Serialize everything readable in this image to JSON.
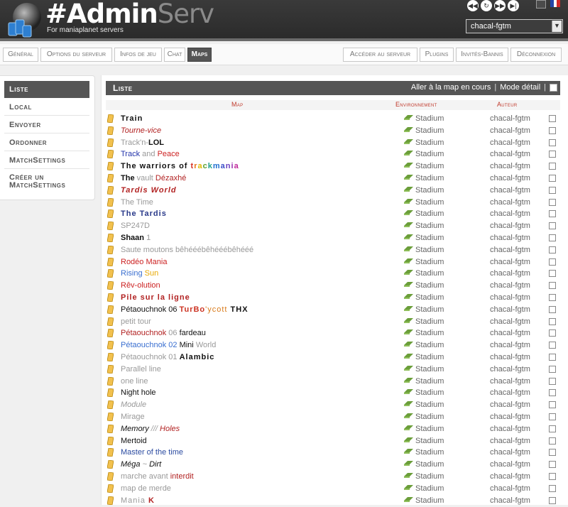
{
  "app": {
    "brand_main": "#Admin",
    "brand_suffix": "Serv",
    "tagline": "For maniaplanet servers"
  },
  "header": {
    "server": "chacal-fgtm",
    "media_icons": [
      "rewind-icon",
      "restart-icon",
      "forward-icon",
      "next-icon"
    ],
    "lang_flags": [
      "gb-flag-icon",
      "fr-flag-icon"
    ]
  },
  "nav": {
    "left": [
      "Général",
      "Options du serveur",
      "Infos de jeu",
      "Chat",
      "Maps"
    ],
    "right": [
      "Accéder au serveur",
      "Plugins",
      "Invités-Bannis",
      "Déconnexion"
    ],
    "active": "Maps"
  },
  "sidebar": {
    "items": [
      "Liste",
      "Local",
      "Envoyer",
      "Ordonner",
      "MatchSettings",
      "Créer un MatchSettings"
    ],
    "active": "Liste"
  },
  "panel": {
    "title": "Liste",
    "goto_current": "Aller à la map en cours",
    "detail_mode": "Mode détail",
    "col_map": "Map",
    "col_env": "Environnement",
    "col_author": "Auteur"
  },
  "colors": {
    "accent_red": "#c0392b",
    "header_dark": "#2e2e2e",
    "panel_head": "#555555",
    "env_icon": "#6b9e3a"
  },
  "maps": [
    {
      "segments": [
        {
          "text": "Train",
          "color": "#111111",
          "style": "b wide"
        }
      ],
      "environment": "Stadium",
      "author": "chacal-fgtm"
    },
    {
      "segments": [
        {
          "text": "Tourne-vice",
          "color": "#b22222",
          "style": "i"
        }
      ],
      "environment": "Stadium",
      "author": "chacal-fgtm"
    },
    {
      "segments": [
        {
          "text": "Track'n-",
          "color": "#999999",
          "style": ""
        },
        {
          "text": "LOL",
          "color": "#111111",
          "style": "b"
        }
      ],
      "environment": "Stadium",
      "author": "chacal-fgtm"
    },
    {
      "segments": [
        {
          "text": "Track ",
          "color": "#2233aa",
          "style": ""
        },
        {
          "text": "and ",
          "color": "#999999",
          "style": ""
        },
        {
          "text": "Peace",
          "color": "#cc2222",
          "style": ""
        }
      ],
      "environment": "Stadium",
      "author": "chacal-fgtm"
    },
    {
      "segments": [
        {
          "text": "The warriors of ",
          "color": "#111111",
          "style": "b wide"
        },
        {
          "text": "t",
          "color": "#d62d20",
          "style": "b wide"
        },
        {
          "text": "r",
          "color": "#e8741a",
          "style": "b wide"
        },
        {
          "text": "a",
          "color": "#e0b800",
          "style": "b wide"
        },
        {
          "text": "c",
          "color": "#5aa02c",
          "style": "b wide"
        },
        {
          "text": "k",
          "color": "#1f9f8a",
          "style": "b wide"
        },
        {
          "text": "m",
          "color": "#1f6fd0",
          "style": "b wide"
        },
        {
          "text": "a",
          "color": "#3b4ec8",
          "style": "b wide"
        },
        {
          "text": "n",
          "color": "#6a3fc0",
          "style": "b wide"
        },
        {
          "text": "i",
          "color": "#9a2fb0",
          "style": "b wide"
        },
        {
          "text": "a",
          "color": "#c0289a",
          "style": "b wide"
        }
      ],
      "environment": "Stadium",
      "author": "chacal-fgtm"
    },
    {
      "segments": [
        {
          "text": "The ",
          "color": "#111111",
          "style": "b"
        },
        {
          "text": "vault ",
          "color": "#999999",
          "style": ""
        },
        {
          "text": "Dézaxhé",
          "color": "#b22222",
          "style": ""
        }
      ],
      "environment": "Stadium",
      "author": "chacal-fgtm"
    },
    {
      "segments": [
        {
          "text": "Tardis World",
          "color": "#b22222",
          "style": "b i wide"
        }
      ],
      "environment": "Stadium",
      "author": "chacal-fgtm"
    },
    {
      "segments": [
        {
          "text": "The Time",
          "color": "#999999",
          "style": ""
        }
      ],
      "environment": "Stadium",
      "author": "chacal-fgtm"
    },
    {
      "segments": [
        {
          "text": "The Tardis",
          "color": "#2a3a8a",
          "style": "b wide"
        }
      ],
      "environment": "Stadium",
      "author": "chacal-fgtm"
    },
    {
      "segments": [
        {
          "text": "SP247D",
          "color": "#999999",
          "style": ""
        }
      ],
      "environment": "Stadium",
      "author": "chacal-fgtm"
    },
    {
      "segments": [
        {
          "text": "Shaan ",
          "color": "#111111",
          "style": "b"
        },
        {
          "text": "1",
          "color": "#999999",
          "style": ""
        }
      ],
      "environment": "Stadium",
      "author": "chacal-fgtm"
    },
    {
      "segments": [
        {
          "text": "Saute moutons bêhééébêhééébêhééé",
          "color": "#999999",
          "style": ""
        }
      ],
      "environment": "Stadium",
      "author": "chacal-fgtm"
    },
    {
      "segments": [
        {
          "text": "Rodéo Mania",
          "color": "#cc2222",
          "style": ""
        }
      ],
      "environment": "Stadium",
      "author": "chacal-fgtm"
    },
    {
      "segments": [
        {
          "text": "Rising ",
          "color": "#3a6fd0",
          "style": ""
        },
        {
          "text": "Sun",
          "color": "#e8a800",
          "style": ""
        }
      ],
      "environment": "Stadium",
      "author": "chacal-fgtm"
    },
    {
      "segments": [
        {
          "text": "Rêv-olution",
          "color": "#cc2222",
          "style": ""
        }
      ],
      "environment": "Stadium",
      "author": "chacal-fgtm"
    },
    {
      "segments": [
        {
          "text": "Pile sur la ligne",
          "color": "#b22222",
          "style": "b wide"
        }
      ],
      "environment": "Stadium",
      "author": "chacal-fgtm"
    },
    {
      "segments": [
        {
          "text": "Pétaouchnok 06 ",
          "color": "#111111",
          "style": ""
        },
        {
          "text": "TurBo",
          "color": "#cc3322",
          "style": "b wide"
        },
        {
          "text": "'ycott ",
          "color": "#d97a1a",
          "style": "wide"
        },
        {
          "text": "THX",
          "color": "#111111",
          "style": "b wide"
        }
      ],
      "environment": "Stadium",
      "author": "chacal-fgtm"
    },
    {
      "segments": [
        {
          "text": "petit tour",
          "color": "#999999",
          "style": ""
        }
      ],
      "environment": "Stadium",
      "author": "chacal-fgtm"
    },
    {
      "segments": [
        {
          "text": "Pétaouchnok ",
          "color": "#b22222",
          "style": ""
        },
        {
          "text": "06 ",
          "color": "#999999",
          "style": ""
        },
        {
          "text": "fardeau",
          "color": "#111111",
          "style": ""
        }
      ],
      "environment": "Stadium",
      "author": "chacal-fgtm"
    },
    {
      "segments": [
        {
          "text": "Pétaouchnok 02 ",
          "color": "#3a6fd0",
          "style": ""
        },
        {
          "text": "Mini ",
          "color": "#111111",
          "style": ""
        },
        {
          "text": "World",
          "color": "#999999",
          "style": ""
        }
      ],
      "environment": "Stadium",
      "author": "chacal-fgtm"
    },
    {
      "segments": [
        {
          "text": "Pétaouchnok 01 ",
          "color": "#999999",
          "style": ""
        },
        {
          "text": "Alambic",
          "color": "#111111",
          "style": "b wide"
        }
      ],
      "environment": "Stadium",
      "author": "chacal-fgtm"
    },
    {
      "segments": [
        {
          "text": "Parallel line",
          "color": "#999999",
          "style": ""
        }
      ],
      "environment": "Stadium",
      "author": "chacal-fgtm"
    },
    {
      "segments": [
        {
          "text": "one line",
          "color": "#999999",
          "style": ""
        }
      ],
      "environment": "Stadium",
      "author": "chacal-fgtm"
    },
    {
      "segments": [
        {
          "text": "Night hole",
          "color": "#111111",
          "style": ""
        }
      ],
      "environment": "Stadium",
      "author": "chacal-fgtm"
    },
    {
      "segments": [
        {
          "text": "Module",
          "color": "#999999",
          "style": "i"
        }
      ],
      "environment": "Stadium",
      "author": "chacal-fgtm"
    },
    {
      "segments": [
        {
          "text": "Mirage",
          "color": "#999999",
          "style": ""
        }
      ],
      "environment": "Stadium",
      "author": "chacal-fgtm"
    },
    {
      "segments": [
        {
          "text": "Memory ",
          "color": "#111111",
          "style": "i"
        },
        {
          "text": "/// ",
          "color": "#999999",
          "style": "i"
        },
        {
          "text": "Holes",
          "color": "#b22222",
          "style": "i"
        }
      ],
      "environment": "Stadium",
      "author": "chacal-fgtm"
    },
    {
      "segments": [
        {
          "text": "Mertoid",
          "color": "#111111",
          "style": ""
        }
      ],
      "environment": "Stadium",
      "author": "chacal-fgtm"
    },
    {
      "segments": [
        {
          "text": "Master of the time",
          "color": "#2a4aa0",
          "style": ""
        }
      ],
      "environment": "Stadium",
      "author": "chacal-fgtm"
    },
    {
      "segments": [
        {
          "text": "Méga ",
          "color": "#111111",
          "style": "i"
        },
        {
          "text": "~ ",
          "color": "#999999",
          "style": "i"
        },
        {
          "text": "Dirt",
          "color": "#111111",
          "style": "i"
        }
      ],
      "environment": "Stadium",
      "author": "chacal-fgtm"
    },
    {
      "segments": [
        {
          "text": "marche avant ",
          "color": "#999999",
          "style": ""
        },
        {
          "text": "interdit",
          "color": "#b22222",
          "style": ""
        }
      ],
      "environment": "Stadium",
      "author": "chacal-fgtm"
    },
    {
      "segments": [
        {
          "text": "map de merde",
          "color": "#999999",
          "style": ""
        }
      ],
      "environment": "Stadium",
      "author": "chacal-fgtm"
    },
    {
      "segments": [
        {
          "text": "Mania ",
          "color": "#999999",
          "style": "wide"
        },
        {
          "text": "K",
          "color": "#b22222",
          "style": "b"
        }
      ],
      "environment": "Stadium",
      "author": "chacal-fgtm"
    }
  ]
}
